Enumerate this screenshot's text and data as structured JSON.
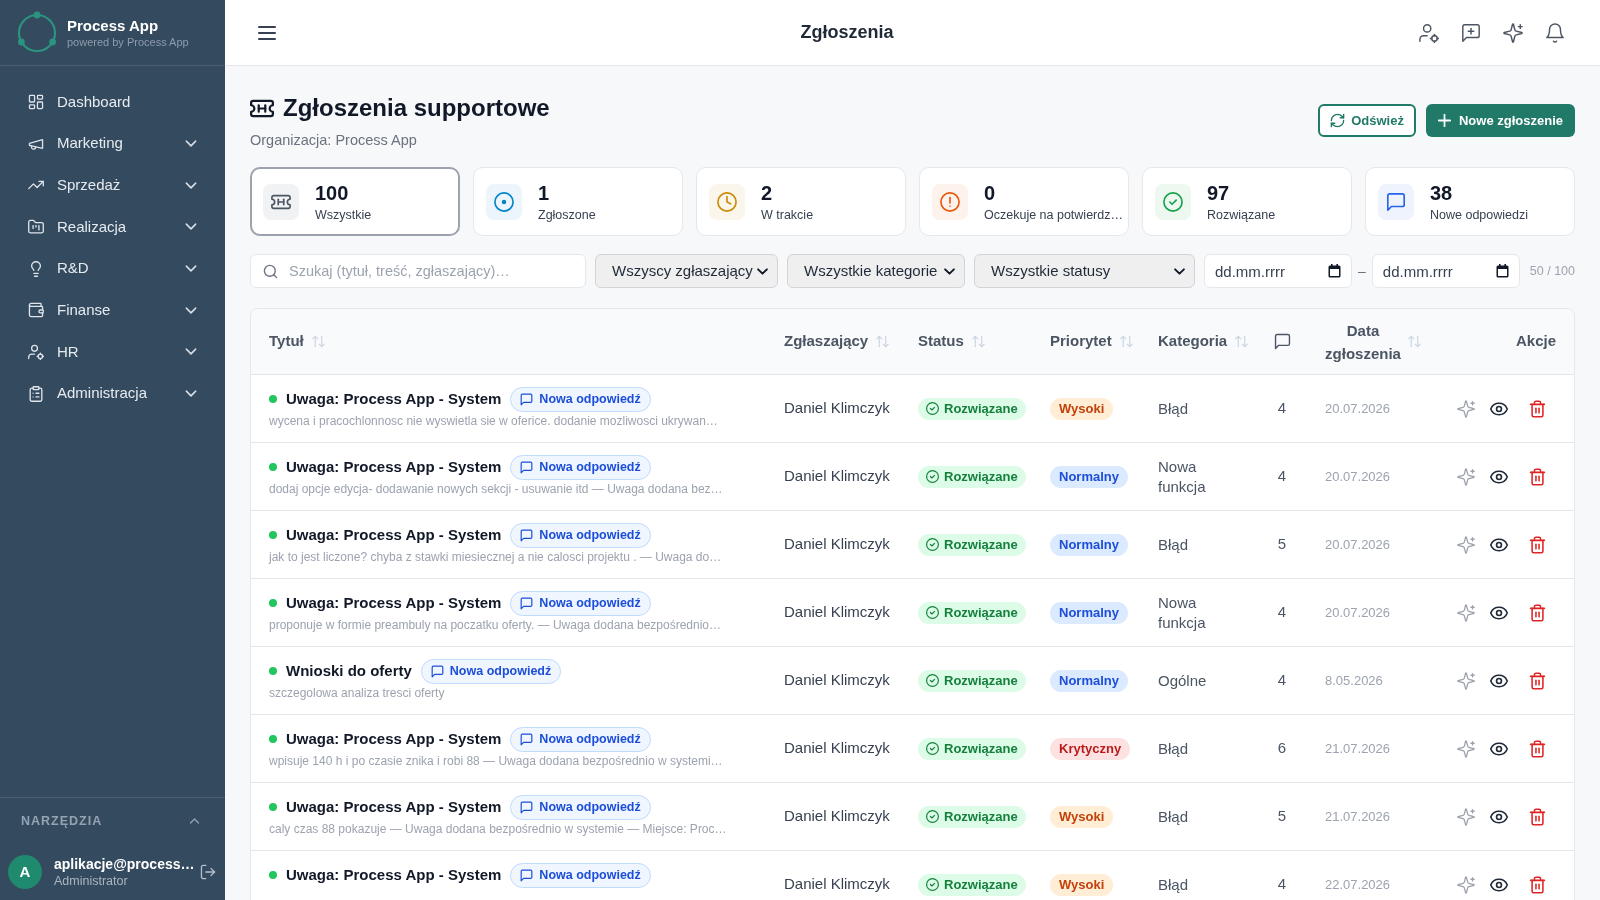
{
  "sidebar": {
    "brand": {
      "name": "Process App",
      "tagline": "powered by Process App"
    },
    "items": [
      {
        "label": "Dashboard",
        "kind": "link",
        "selected": false
      },
      {
        "label": "Marketing",
        "kind": "group",
        "expanded": false,
        "selected": false
      },
      {
        "label": "Sprzedaż",
        "kind": "group",
        "expanded": false,
        "selected": false
      },
      {
        "label": "Realizacja",
        "kind": "group",
        "expanded": false,
        "selected": false
      },
      {
        "label": "R&D",
        "kind": "group",
        "expanded": false,
        "selected": false
      },
      {
        "label": "Finanse",
        "kind": "group",
        "expanded": false,
        "selected": false
      },
      {
        "label": "HR",
        "kind": "group",
        "expanded": false,
        "selected": false
      },
      {
        "label": "Administracja",
        "kind": "group",
        "expanded": false,
        "selected": false
      }
    ],
    "tools": {
      "label": "NARZĘDZIA",
      "expanded": false
    },
    "user": {
      "initial": "A",
      "email": "aplikacje@process…",
      "role": "Administrator"
    }
  },
  "topbar": {
    "title": "Zgłoszenia"
  },
  "page": {
    "title": "Zgłoszenia supportowe",
    "subtitle": "Organizacja: Process App",
    "buttons": [
      {
        "label": "Odśwież",
        "kind": "secondary"
      },
      {
        "label": "Nowe zgłoszenie",
        "kind": "primary"
      }
    ]
  },
  "stats": [
    {
      "value": "100",
      "label": "Wszystkie",
      "color": "#4b5563",
      "selected": true
    },
    {
      "value": "1",
      "label": "Zgłoszone",
      "color": "#0284c7",
      "selected": false
    },
    {
      "value": "2",
      "label": "W trakcie",
      "color": "#ca8a04",
      "selected": false
    },
    {
      "value": "0",
      "label": "Oczekuje na potwierdz…",
      "color": "#ea580c",
      "selected": false
    },
    {
      "value": "97",
      "label": "Rozwiązane",
      "color": "#16a34a",
      "selected": false
    },
    {
      "value": "38",
      "label": "Nowe odpowiedzi",
      "color": "#2563eb",
      "selected": false
    }
  ],
  "filters": {
    "search": {
      "placeholder": "Szukaj (tytuł, treść, zgłaszający)…"
    },
    "selects": [
      "Wszyscy zgłaszający",
      "Wszystkie kategorie",
      "Wszystkie statusy"
    ],
    "date_from": {
      "placeholder": "dd.mm.rrrr"
    },
    "separator": "–",
    "date_to": {
      "placeholder": "dd.mm.rrrr"
    },
    "count": "50 / 100"
  },
  "table": {
    "columns": [
      {
        "label": "Tytuł",
        "kind": "text",
        "sortable": true
      },
      {
        "label": "Zgłaszający",
        "kind": "text",
        "sortable": true
      },
      {
        "label": "Status",
        "kind": "text",
        "sortable": true
      },
      {
        "label": "Priorytet",
        "kind": "text",
        "sortable": true
      },
      {
        "label": "Kategoria",
        "kind": "text",
        "sortable": true
      },
      {
        "kind": "icon",
        "sortable": false
      },
      {
        "label": "Data zgłoszenia",
        "kind": "text",
        "sortable": true
      },
      {
        "label": "Akcje",
        "kind": "text",
        "sortable": false
      }
    ],
    "rows": [
      {
        "color": "#22c55e",
        "title": "Uwaga: Process App - System",
        "badge": "Nowa odpowiedź",
        "description": "wycena i pracochlonnosc nie wyswietla sie w oferice. dodanie mozliwosci ukrywan…",
        "reporter": "Daniel Klimczyk",
        "status": {
          "label": "Rozwiązane",
          "kind": "resolved"
        },
        "priority": {
          "label": "Wysoki",
          "kind": "high"
        },
        "category": "Błąd",
        "comments": "4",
        "date": "20.07.2026"
      },
      {
        "color": "#22c55e",
        "title": "Uwaga: Process App - System",
        "badge": "Nowa odpowiedź",
        "description": "dodaj opcje edycja- dodawanie nowych sekcji - usuwanie itd — Uwaga dodana bez…",
        "reporter": "Daniel Klimczyk",
        "status": {
          "label": "Rozwiązane",
          "kind": "resolved"
        },
        "priority": {
          "label": "Normalny",
          "kind": "normal"
        },
        "category": "Nowa funkcja",
        "comments": "4",
        "date": "20.07.2026"
      },
      {
        "color": "#22c55e",
        "title": "Uwaga: Process App - System",
        "badge": "Nowa odpowiedź",
        "description": "jak to jest liczone? chyba z stawki miesiecznej a nie calosci projektu . — Uwaga do…",
        "reporter": "Daniel Klimczyk",
        "status": {
          "label": "Rozwiązane",
          "kind": "resolved"
        },
        "priority": {
          "label": "Normalny",
          "kind": "normal"
        },
        "category": "Błąd",
        "comments": "5",
        "date": "20.07.2026"
      },
      {
        "color": "#22c55e",
        "title": "Uwaga: Process App - System",
        "badge": "Nowa odpowiedź",
        "description": "proponuje w formie preambuly na poczatku oferty. — Uwaga dodana bezpośrednio…",
        "reporter": "Daniel Klimczyk",
        "status": {
          "label": "Rozwiązane",
          "kind": "resolved"
        },
        "priority": {
          "label": "Normalny",
          "kind": "normal"
        },
        "category": "Nowa funkcja",
        "comments": "4",
        "date": "20.07.2026"
      },
      {
        "color": "#22c55e",
        "title": "Wnioski do oferty",
        "badge": "Nowa odpowiedź",
        "description": "szczegolowa analiza tresci oferty",
        "reporter": "Daniel Klimczyk",
        "status": {
          "label": "Rozwiązane",
          "kind": "resolved"
        },
        "priority": {
          "label": "Normalny",
          "kind": "normal"
        },
        "category": "Ogólne",
        "comments": "4",
        "date": "8.05.2026"
      },
      {
        "color": "#22c55e",
        "title": "Uwaga: Process App - System",
        "badge": "Nowa odpowiedź",
        "description": "wpisuje 140 h i po czasie znika i robi 88 — Uwaga dodana bezpośrednio w systemi…",
        "reporter": "Daniel Klimczyk",
        "status": {
          "label": "Rozwiązane",
          "kind": "resolved"
        },
        "priority": {
          "label": "Krytyczny",
          "kind": "critical"
        },
        "category": "Błąd",
        "comments": "6",
        "date": "21.07.2026"
      },
      {
        "color": "#22c55e",
        "title": "Uwaga: Process App - System",
        "badge": "Nowa odpowiedź",
        "description": "caly czas 88 pokazuje — Uwaga dodana bezpośrednio w systemie — Miejsce: Proc…",
        "reporter": "Daniel Klimczyk",
        "status": {
          "label": "Rozwiązane",
          "kind": "resolved"
        },
        "priority": {
          "label": "Wysoki",
          "kind": "high"
        },
        "category": "Błąd",
        "comments": "5",
        "date": "21.07.2026"
      },
      {
        "color": "#22c55e",
        "title": "Uwaga: Process App - System",
        "badge": "Nowa odpowiedź",
        "reporter": "Daniel Klimczyk",
        "status": {
          "label": "Rozwiązane",
          "kind": "resolved"
        },
        "priority": {
          "label": "Wysoki",
          "kind": "high"
        },
        "category": "Błąd",
        "comments": "4",
        "date": "22.07.2026"
      }
    ]
  }
}
